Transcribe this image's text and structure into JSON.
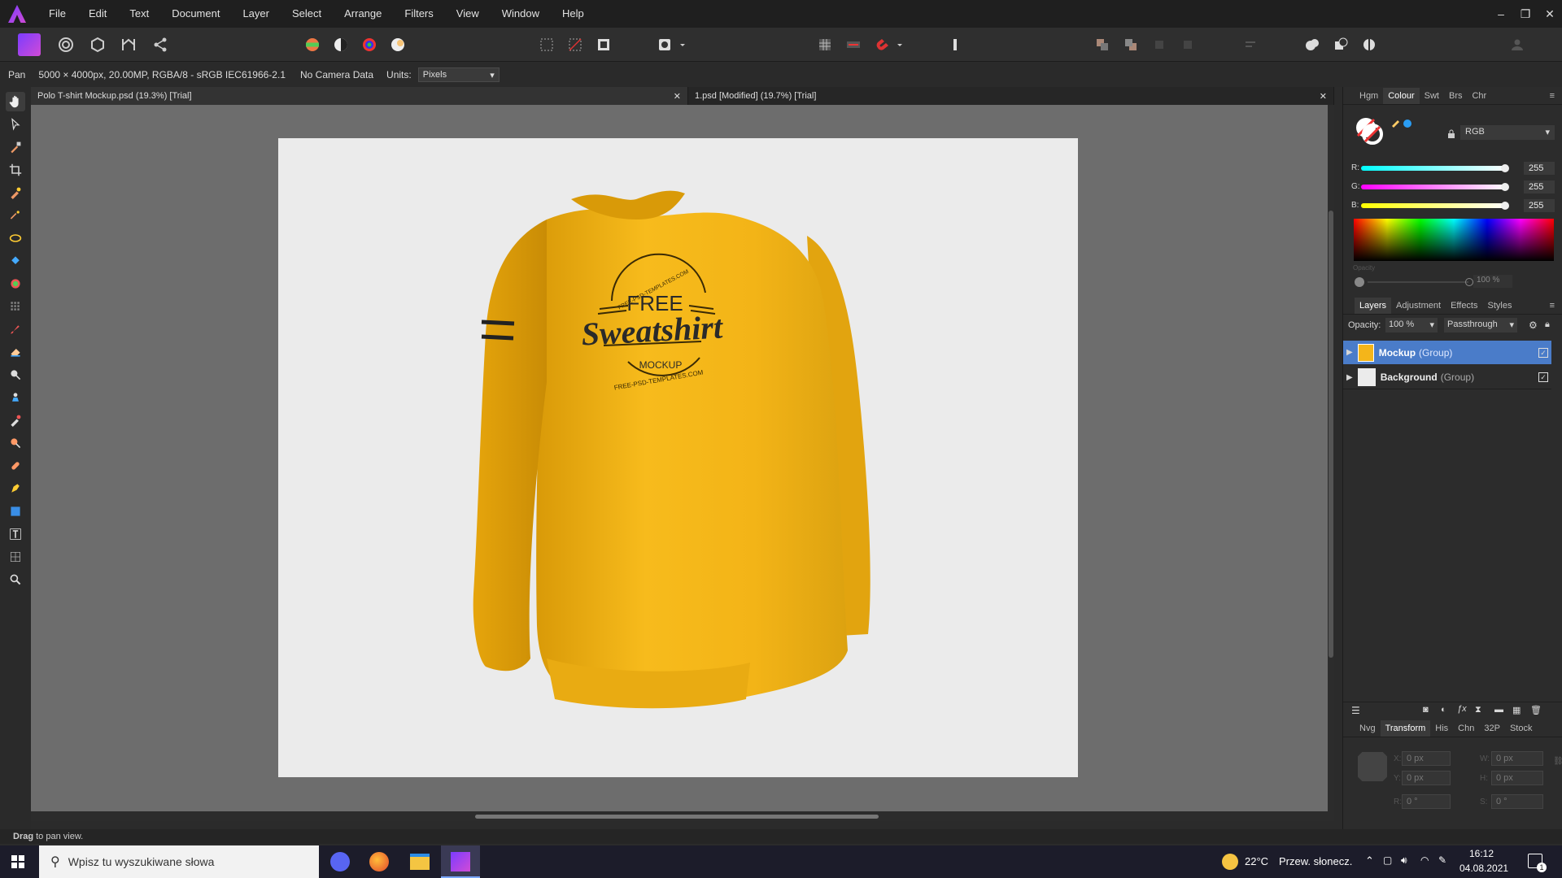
{
  "menu": [
    "File",
    "Edit",
    "Text",
    "Document",
    "Layer",
    "Select",
    "Arrange",
    "Filters",
    "View",
    "Window",
    "Help"
  ],
  "window_controls": [
    "–",
    "❐",
    "✕"
  ],
  "context": {
    "tool": "Pan",
    "doc_info": "5000 × 4000px, 20.00MP, RGBA/8 - sRGB IEC61966-2.1",
    "camera": "No Camera Data",
    "units_label": "Units:",
    "units_value": "Pixels"
  },
  "tabs": [
    {
      "label": "Polo T-shirt Mockup.psd (19.3%) [Trial]",
      "close": "✕"
    },
    {
      "label": "1.psd [Modified] (19.7%) [Trial]",
      "close": "✕"
    }
  ],
  "mockup": {
    "line1": "FREE",
    "line2": "Sweatshirt",
    "line3": "MOCKUP",
    "arc_top": "FREE-PSD-TEMPLATES.COM",
    "arc_bottom": "FREE-PSD-TEMPLATES.COM",
    "shirt_color": "#f4b51a",
    "bg_color": "#ebebeb"
  },
  "colour_panel": {
    "tabs": [
      "Hgm",
      "Colour",
      "Swt",
      "Brs",
      "Chr"
    ],
    "active_tab": "Colour",
    "model": "RGB",
    "channels": [
      {
        "label": "R:",
        "value": "255"
      },
      {
        "label": "G:",
        "value": "255"
      },
      {
        "label": "B:",
        "value": "255"
      }
    ],
    "opacity_label": "Opacity",
    "opacity_value": "100 %"
  },
  "layers_panel": {
    "tabs": [
      "Layers",
      "Adjustment",
      "Effects",
      "Styles"
    ],
    "active_tab": "Layers",
    "opacity_label": "Opacity:",
    "opacity_value": "100 %",
    "blend_mode": "Passthrough",
    "layers": [
      {
        "name": "Mockup",
        "type": "(Group)",
        "selected": true
      },
      {
        "name": "Background",
        "type": "(Group)",
        "selected": false
      }
    ]
  },
  "transform_panel": {
    "tabs": [
      "Nvg",
      "Transform",
      "His",
      "Chn",
      "32P",
      "Stock"
    ],
    "active_tab": "Transform",
    "fields": [
      {
        "label": "X:",
        "value": "0 px"
      },
      {
        "label": "W:",
        "value": "0 px"
      },
      {
        "label": "Y:",
        "value": "0 px"
      },
      {
        "label": "H:",
        "value": "0 px"
      },
      {
        "label": "R:",
        "value": "0 °"
      },
      {
        "label": "S:",
        "value": "0 °"
      }
    ]
  },
  "status": {
    "bold": "Drag",
    "rest": " to pan view."
  },
  "taskbar": {
    "search_placeholder": "Wpisz tu wyszukiwane słowa",
    "weather_temp": "22°C",
    "weather_text": "Przew. słonecz.",
    "time": "16:12",
    "date": "04.08.2021",
    "notif_count": "1"
  },
  "colors": {
    "accent": "#4a7cc9",
    "selected_row": "#4a7cc9",
    "app": "#8a3cf0"
  }
}
